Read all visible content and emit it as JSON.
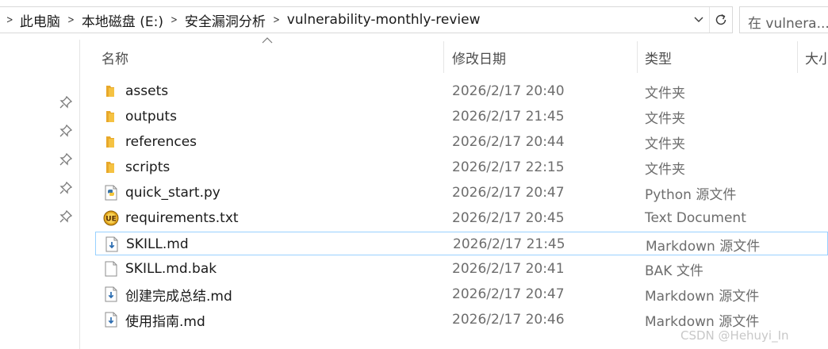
{
  "breadcrumb": [
    "此电脑",
    "本地磁盘 (E:)",
    "安全漏洞分析",
    "vulnerability-monthly-review"
  ],
  "search": {
    "placeholder": "在 vulnera..."
  },
  "columns": {
    "name": "名称",
    "date": "修改日期",
    "type": "类型",
    "size": "大小"
  },
  "files": [
    {
      "icon": "folder-icon",
      "name": "assets",
      "date": "2026/2/17 20:40",
      "type": "文件夹"
    },
    {
      "icon": "folder-icon",
      "name": "outputs",
      "date": "2026/2/17 21:45",
      "type": "文件夹"
    },
    {
      "icon": "folder-icon",
      "name": "references",
      "date": "2026/2/17 20:44",
      "type": "文件夹"
    },
    {
      "icon": "folder-icon",
      "name": "scripts",
      "date": "2026/2/17 22:15",
      "type": "文件夹"
    },
    {
      "icon": "python-file-icon",
      "name": "quick_start.py",
      "date": "2026/2/17 20:47",
      "type": "Python 源文件"
    },
    {
      "icon": "ultraedit-file-icon",
      "name": "requirements.txt",
      "date": "2026/2/17 20:45",
      "type": "Text Document"
    },
    {
      "icon": "markdown-file-icon",
      "name": "SKILL.md",
      "date": "2026/2/17 21:45",
      "type": "Markdown 源文件",
      "focused": true
    },
    {
      "icon": "blank-file-icon",
      "name": "SKILL.md.bak",
      "date": "2026/2/17 20:41",
      "type": "BAK 文件"
    },
    {
      "icon": "markdown-file-icon",
      "name": "创建完成总结.md",
      "date": "2026/2/17 20:47",
      "type": "Markdown 源文件"
    },
    {
      "icon": "markdown-file-icon",
      "name": "使用指南.md",
      "date": "2026/2/17 20:46",
      "type": "Markdown 源文件"
    }
  ],
  "watermark": "CSDN @Hehuyi_In",
  "colors": {
    "folder": "#f5c242",
    "focus_border": "#99d1ff",
    "secondary_text": "#6d6d6d"
  }
}
